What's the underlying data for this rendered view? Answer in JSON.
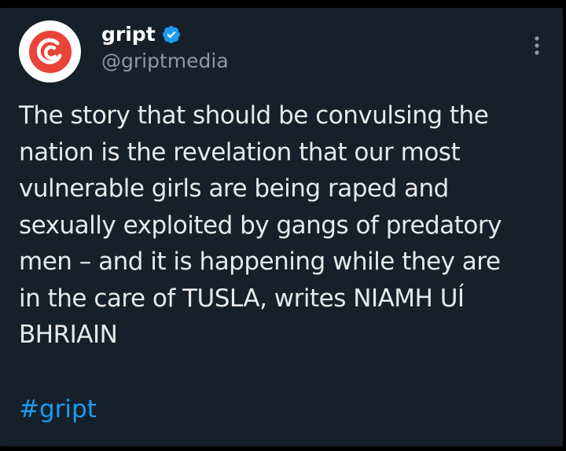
{
  "tweet": {
    "display_name": "gript",
    "handle": "@griptmedia",
    "verified_icon": "verified-badge-icon",
    "more_icon": "more-vertical-icon",
    "avatar_icon": "gript-logo-icon",
    "text": "The story that should be convulsing the\nnation is the revelation that our most\nvulnerable girls are being raped and\nsexually exploited by gangs of predatory\nmen – and it is happening while they are\nin the care of TUSLA, writes NIAMH UÍ\nBHRIAIN",
    "hashtag": "#gript"
  },
  "colors": {
    "background": "#15202b",
    "text": "#e7e9ea",
    "secondary_text": "#8b98a5",
    "accent": "#1d9bf0",
    "logo_red": "#e8443a"
  }
}
